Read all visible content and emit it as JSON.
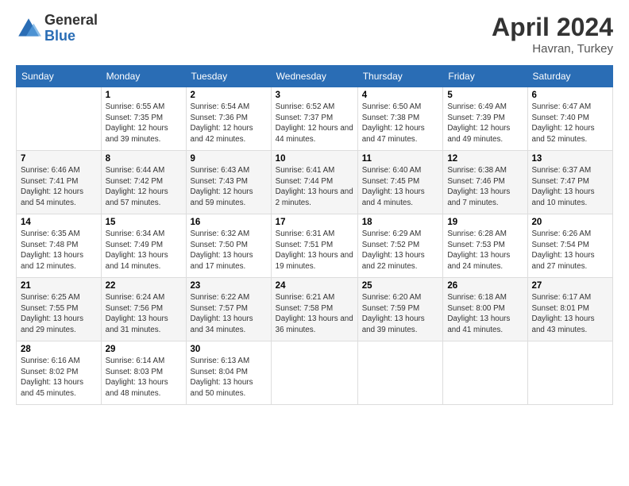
{
  "header": {
    "logo_general": "General",
    "logo_blue": "Blue",
    "title": "April 2024",
    "location": "Havran, Turkey"
  },
  "weekdays": [
    "Sunday",
    "Monday",
    "Tuesday",
    "Wednesday",
    "Thursday",
    "Friday",
    "Saturday"
  ],
  "weeks": [
    [
      {
        "day": "",
        "sunrise": "",
        "sunset": "",
        "daylight": ""
      },
      {
        "day": "1",
        "sunrise": "Sunrise: 6:55 AM",
        "sunset": "Sunset: 7:35 PM",
        "daylight": "Daylight: 12 hours and 39 minutes."
      },
      {
        "day": "2",
        "sunrise": "Sunrise: 6:54 AM",
        "sunset": "Sunset: 7:36 PM",
        "daylight": "Daylight: 12 hours and 42 minutes."
      },
      {
        "day": "3",
        "sunrise": "Sunrise: 6:52 AM",
        "sunset": "Sunset: 7:37 PM",
        "daylight": "Daylight: 12 hours and 44 minutes."
      },
      {
        "day": "4",
        "sunrise": "Sunrise: 6:50 AM",
        "sunset": "Sunset: 7:38 PM",
        "daylight": "Daylight: 12 hours and 47 minutes."
      },
      {
        "day": "5",
        "sunrise": "Sunrise: 6:49 AM",
        "sunset": "Sunset: 7:39 PM",
        "daylight": "Daylight: 12 hours and 49 minutes."
      },
      {
        "day": "6",
        "sunrise": "Sunrise: 6:47 AM",
        "sunset": "Sunset: 7:40 PM",
        "daylight": "Daylight: 12 hours and 52 minutes."
      }
    ],
    [
      {
        "day": "7",
        "sunrise": "Sunrise: 6:46 AM",
        "sunset": "Sunset: 7:41 PM",
        "daylight": "Daylight: 12 hours and 54 minutes."
      },
      {
        "day": "8",
        "sunrise": "Sunrise: 6:44 AM",
        "sunset": "Sunset: 7:42 PM",
        "daylight": "Daylight: 12 hours and 57 minutes."
      },
      {
        "day": "9",
        "sunrise": "Sunrise: 6:43 AM",
        "sunset": "Sunset: 7:43 PM",
        "daylight": "Daylight: 12 hours and 59 minutes."
      },
      {
        "day": "10",
        "sunrise": "Sunrise: 6:41 AM",
        "sunset": "Sunset: 7:44 PM",
        "daylight": "Daylight: 13 hours and 2 minutes."
      },
      {
        "day": "11",
        "sunrise": "Sunrise: 6:40 AM",
        "sunset": "Sunset: 7:45 PM",
        "daylight": "Daylight: 13 hours and 4 minutes."
      },
      {
        "day": "12",
        "sunrise": "Sunrise: 6:38 AM",
        "sunset": "Sunset: 7:46 PM",
        "daylight": "Daylight: 13 hours and 7 minutes."
      },
      {
        "day": "13",
        "sunrise": "Sunrise: 6:37 AM",
        "sunset": "Sunset: 7:47 PM",
        "daylight": "Daylight: 13 hours and 10 minutes."
      }
    ],
    [
      {
        "day": "14",
        "sunrise": "Sunrise: 6:35 AM",
        "sunset": "Sunset: 7:48 PM",
        "daylight": "Daylight: 13 hours and 12 minutes."
      },
      {
        "day": "15",
        "sunrise": "Sunrise: 6:34 AM",
        "sunset": "Sunset: 7:49 PM",
        "daylight": "Daylight: 13 hours and 14 minutes."
      },
      {
        "day": "16",
        "sunrise": "Sunrise: 6:32 AM",
        "sunset": "Sunset: 7:50 PM",
        "daylight": "Daylight: 13 hours and 17 minutes."
      },
      {
        "day": "17",
        "sunrise": "Sunrise: 6:31 AM",
        "sunset": "Sunset: 7:51 PM",
        "daylight": "Daylight: 13 hours and 19 minutes."
      },
      {
        "day": "18",
        "sunrise": "Sunrise: 6:29 AM",
        "sunset": "Sunset: 7:52 PM",
        "daylight": "Daylight: 13 hours and 22 minutes."
      },
      {
        "day": "19",
        "sunrise": "Sunrise: 6:28 AM",
        "sunset": "Sunset: 7:53 PM",
        "daylight": "Daylight: 13 hours and 24 minutes."
      },
      {
        "day": "20",
        "sunrise": "Sunrise: 6:26 AM",
        "sunset": "Sunset: 7:54 PM",
        "daylight": "Daylight: 13 hours and 27 minutes."
      }
    ],
    [
      {
        "day": "21",
        "sunrise": "Sunrise: 6:25 AM",
        "sunset": "Sunset: 7:55 PM",
        "daylight": "Daylight: 13 hours and 29 minutes."
      },
      {
        "day": "22",
        "sunrise": "Sunrise: 6:24 AM",
        "sunset": "Sunset: 7:56 PM",
        "daylight": "Daylight: 13 hours and 31 minutes."
      },
      {
        "day": "23",
        "sunrise": "Sunrise: 6:22 AM",
        "sunset": "Sunset: 7:57 PM",
        "daylight": "Daylight: 13 hours and 34 minutes."
      },
      {
        "day": "24",
        "sunrise": "Sunrise: 6:21 AM",
        "sunset": "Sunset: 7:58 PM",
        "daylight": "Daylight: 13 hours and 36 minutes."
      },
      {
        "day": "25",
        "sunrise": "Sunrise: 6:20 AM",
        "sunset": "Sunset: 7:59 PM",
        "daylight": "Daylight: 13 hours and 39 minutes."
      },
      {
        "day": "26",
        "sunrise": "Sunrise: 6:18 AM",
        "sunset": "Sunset: 8:00 PM",
        "daylight": "Daylight: 13 hours and 41 minutes."
      },
      {
        "day": "27",
        "sunrise": "Sunrise: 6:17 AM",
        "sunset": "Sunset: 8:01 PM",
        "daylight": "Daylight: 13 hours and 43 minutes."
      }
    ],
    [
      {
        "day": "28",
        "sunrise": "Sunrise: 6:16 AM",
        "sunset": "Sunset: 8:02 PM",
        "daylight": "Daylight: 13 hours and 45 minutes."
      },
      {
        "day": "29",
        "sunrise": "Sunrise: 6:14 AM",
        "sunset": "Sunset: 8:03 PM",
        "daylight": "Daylight: 13 hours and 48 minutes."
      },
      {
        "day": "30",
        "sunrise": "Sunrise: 6:13 AM",
        "sunset": "Sunset: 8:04 PM",
        "daylight": "Daylight: 13 hours and 50 minutes."
      },
      {
        "day": "",
        "sunrise": "",
        "sunset": "",
        "daylight": ""
      },
      {
        "day": "",
        "sunrise": "",
        "sunset": "",
        "daylight": ""
      },
      {
        "day": "",
        "sunrise": "",
        "sunset": "",
        "daylight": ""
      },
      {
        "day": "",
        "sunrise": "",
        "sunset": "",
        "daylight": ""
      }
    ]
  ]
}
